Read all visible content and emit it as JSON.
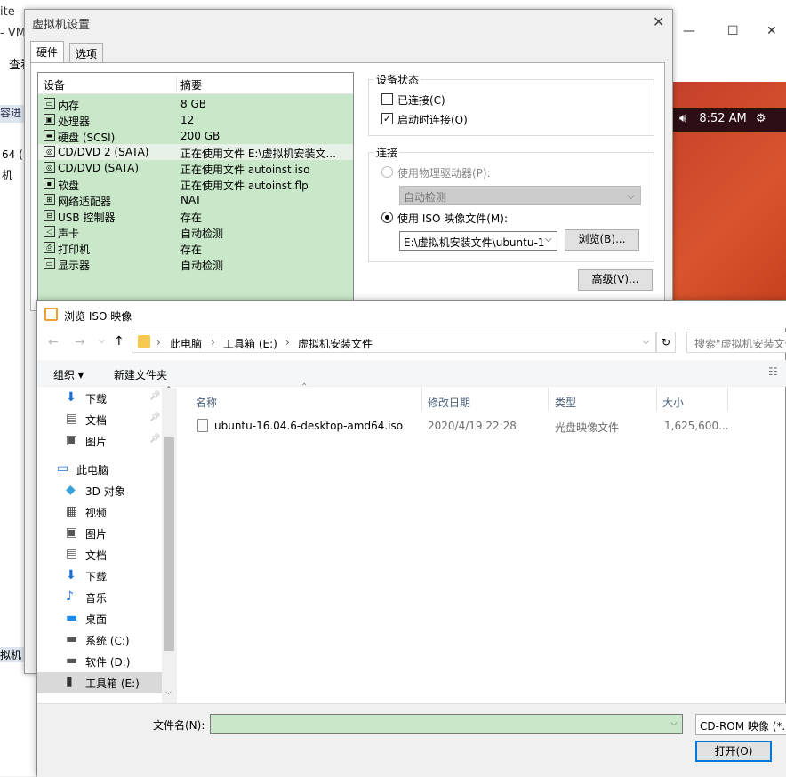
{
  "background_window": {
    "title_fragment": "ite-",
    "title_suffix": "- VM",
    "menu_fragment": "查看",
    "list_fragment": "容进",
    "item_64": "64 (",
    "item_ji": "机",
    "status_fragment": "拟机",
    "ubuntu_time": "8:52 AM"
  },
  "settings": {
    "title": "虚拟机设置",
    "tabs": [
      "硬件",
      "选项"
    ],
    "columns": {
      "device": "设备",
      "summary": "摘要"
    },
    "devices": [
      {
        "icon": "memory-icon",
        "glyph": "▭",
        "name": "内存",
        "summary": "8 GB"
      },
      {
        "icon": "cpu-icon",
        "glyph": "▣",
        "name": "处理器",
        "summary": "12"
      },
      {
        "icon": "disk-icon",
        "glyph": "▬",
        "name": "硬盘 (SCSI)",
        "summary": "200 GB"
      },
      {
        "icon": "cd-icon",
        "glyph": "◎",
        "name": "CD/DVD 2 (SATA)",
        "summary": "正在使用文件 E:\\虚拟机安装文..."
      },
      {
        "icon": "cd-icon",
        "glyph": "◎",
        "name": "CD/DVD (SATA)",
        "summary": "正在使用文件 autoinst.iso"
      },
      {
        "icon": "floppy-icon",
        "glyph": "▪",
        "name": "软盘",
        "summary": "正在使用文件 autoinst.flp"
      },
      {
        "icon": "network-icon",
        "glyph": "⊞",
        "name": "网络适配器",
        "summary": "NAT"
      },
      {
        "icon": "usb-icon",
        "glyph": "⊟",
        "name": "USB 控制器",
        "summary": "存在"
      },
      {
        "icon": "sound-icon",
        "glyph": "◁",
        "name": "声卡",
        "summary": "自动检测"
      },
      {
        "icon": "printer-icon",
        "glyph": "⎙",
        "name": "打印机",
        "summary": "存在"
      },
      {
        "icon": "display-icon",
        "glyph": "▭",
        "name": "显示器",
        "summary": "自动检测"
      }
    ],
    "status_group": "设备状态",
    "connected_label": "已连接(C)",
    "connect_on_start_label": "启动时连接(O)",
    "connect_group": "连接",
    "physical_drive_label": "使用物理驱动器(P):",
    "auto_detect": "自动检测",
    "iso_label": "使用 ISO 映像文件(M):",
    "iso_path": "E:\\虚拟机安装文件\\ubuntu-1",
    "browse_button": "浏览(B)...",
    "advanced_button": "高级(V)..."
  },
  "browse": {
    "title": "浏览 ISO 映像",
    "breadcrumb": [
      "此电脑",
      "工具箱 (E:)",
      "虚拟机安装文件"
    ],
    "search_placeholder": "搜索\"虚拟机安装文件\"",
    "organize": "组织 ▾",
    "new_folder": "新建文件夹",
    "nav": [
      {
        "label": "下载",
        "icon": "download-icon",
        "glyph": "⬇",
        "color": "#1e6fd9",
        "pinned": true
      },
      {
        "label": "文档",
        "icon": "document-icon",
        "glyph": "▤",
        "color": "#555",
        "pinned": true
      },
      {
        "label": "图片",
        "icon": "picture-icon",
        "glyph": "▣",
        "color": "#555",
        "pinned": true
      },
      {
        "label": "此电脑",
        "icon": "computer-icon",
        "glyph": "▭",
        "color": "#1e6fd9",
        "pinned": false
      },
      {
        "label": "3D 对象",
        "icon": "3d-objects-icon",
        "glyph": "◆",
        "color": "#38a0d8",
        "pinned": false
      },
      {
        "label": "视频",
        "icon": "video-icon",
        "glyph": "▦",
        "color": "#444",
        "pinned": false
      },
      {
        "label": "图片",
        "icon": "picture-icon",
        "glyph": "▣",
        "color": "#555",
        "pinned": false
      },
      {
        "label": "文档",
        "icon": "document-icon",
        "glyph": "▤",
        "color": "#555",
        "pinned": false
      },
      {
        "label": "下载",
        "icon": "download-icon",
        "glyph": "⬇",
        "color": "#1e6fd9",
        "pinned": false
      },
      {
        "label": "音乐",
        "icon": "music-icon",
        "glyph": "♪",
        "color": "#1e6fd9",
        "pinned": false
      },
      {
        "label": "桌面",
        "icon": "desktop-icon",
        "glyph": "▬",
        "color": "#1e88e5",
        "pinned": false
      },
      {
        "label": "系统 (C:)",
        "icon": "drive-c-icon",
        "glyph": "▬",
        "color": "#555",
        "pinned": false
      },
      {
        "label": "软件 (D:)",
        "icon": "drive-d-icon",
        "glyph": "▬",
        "color": "#555",
        "pinned": false
      },
      {
        "label": "工具箱 (E:)",
        "icon": "drive-e-icon",
        "glyph": "▮",
        "color": "#333",
        "pinned": false
      }
    ],
    "columns": {
      "name": "名称",
      "date": "修改日期",
      "type": "类型",
      "size": "大小"
    },
    "files": [
      {
        "name": "ubuntu-16.04.6-desktop-amd64.iso",
        "date": "2020/4/19 22:28",
        "type": "光盘映像文件",
        "size": "1,625,600..."
      }
    ],
    "filename_label": "文件名(N):",
    "filename_value": "",
    "filetype": "CD-ROM 映像 (*.iso)",
    "open_button": "打开(O)"
  }
}
